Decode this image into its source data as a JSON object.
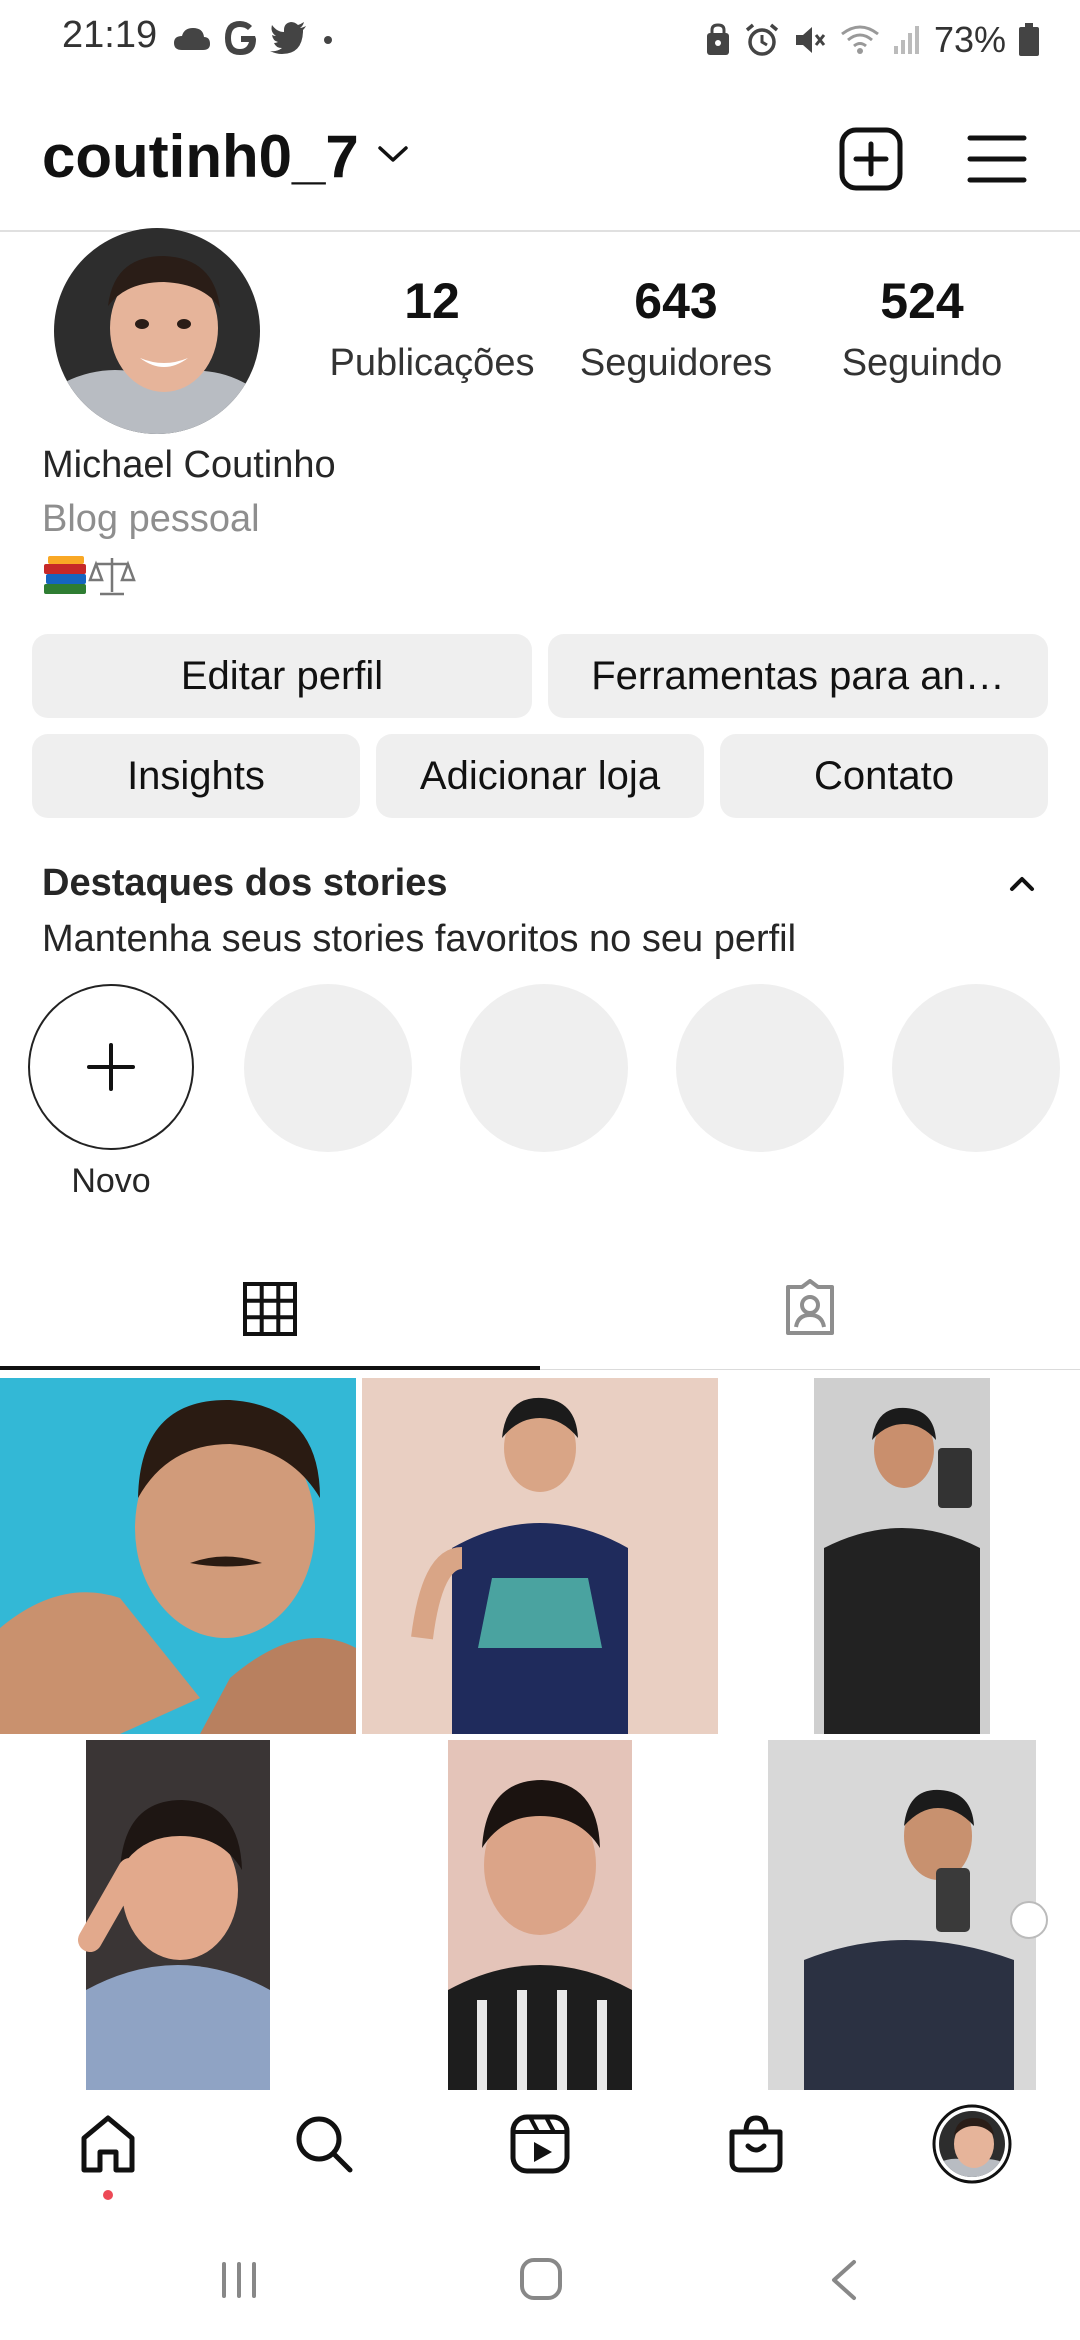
{
  "status_bar": {
    "time": "21:19",
    "battery": "73%",
    "left_icons": [
      "cloud-icon",
      "google-icon",
      "twitter-icon",
      "dot-icon"
    ],
    "right_icons": [
      "security-icon",
      "alarm-icon",
      "mute-icon",
      "wifi-icon",
      "signal-icon",
      "battery-icon"
    ]
  },
  "header": {
    "username": "coutinh0_7"
  },
  "profile": {
    "stats": [
      {
        "count": "12",
        "label": "Publicações"
      },
      {
        "count": "643",
        "label": "Seguidores"
      },
      {
        "count": "524",
        "label": "Seguindo"
      }
    ],
    "full_name": "Michael Coutinho",
    "category": "Blog pessoal",
    "bio_emojis": [
      "books-icon",
      "balance-scale-icon"
    ]
  },
  "buttons": {
    "edit_profile": "Editar perfil",
    "tools": "Ferramentas para an…",
    "insights": "Insights",
    "add_shop": "Adicionar loja",
    "contact": "Contato"
  },
  "highlights": {
    "title": "Destaques dos stories",
    "subtitle": "Mantenha seus stories favoritos no seu perfil",
    "new_label": "Novo"
  },
  "tabs": [
    {
      "icon": "grid-icon",
      "active": true
    },
    {
      "icon": "tagged-icon",
      "active": false
    }
  ],
  "colors": {
    "accent_dot": "#ed4956",
    "button_bg": "#efefef",
    "text": "#262626",
    "secondary_text": "#8e8e8e"
  },
  "bottom_nav": [
    "home-icon",
    "search-icon",
    "reels-icon",
    "shop-icon",
    "profile-avatar"
  ]
}
